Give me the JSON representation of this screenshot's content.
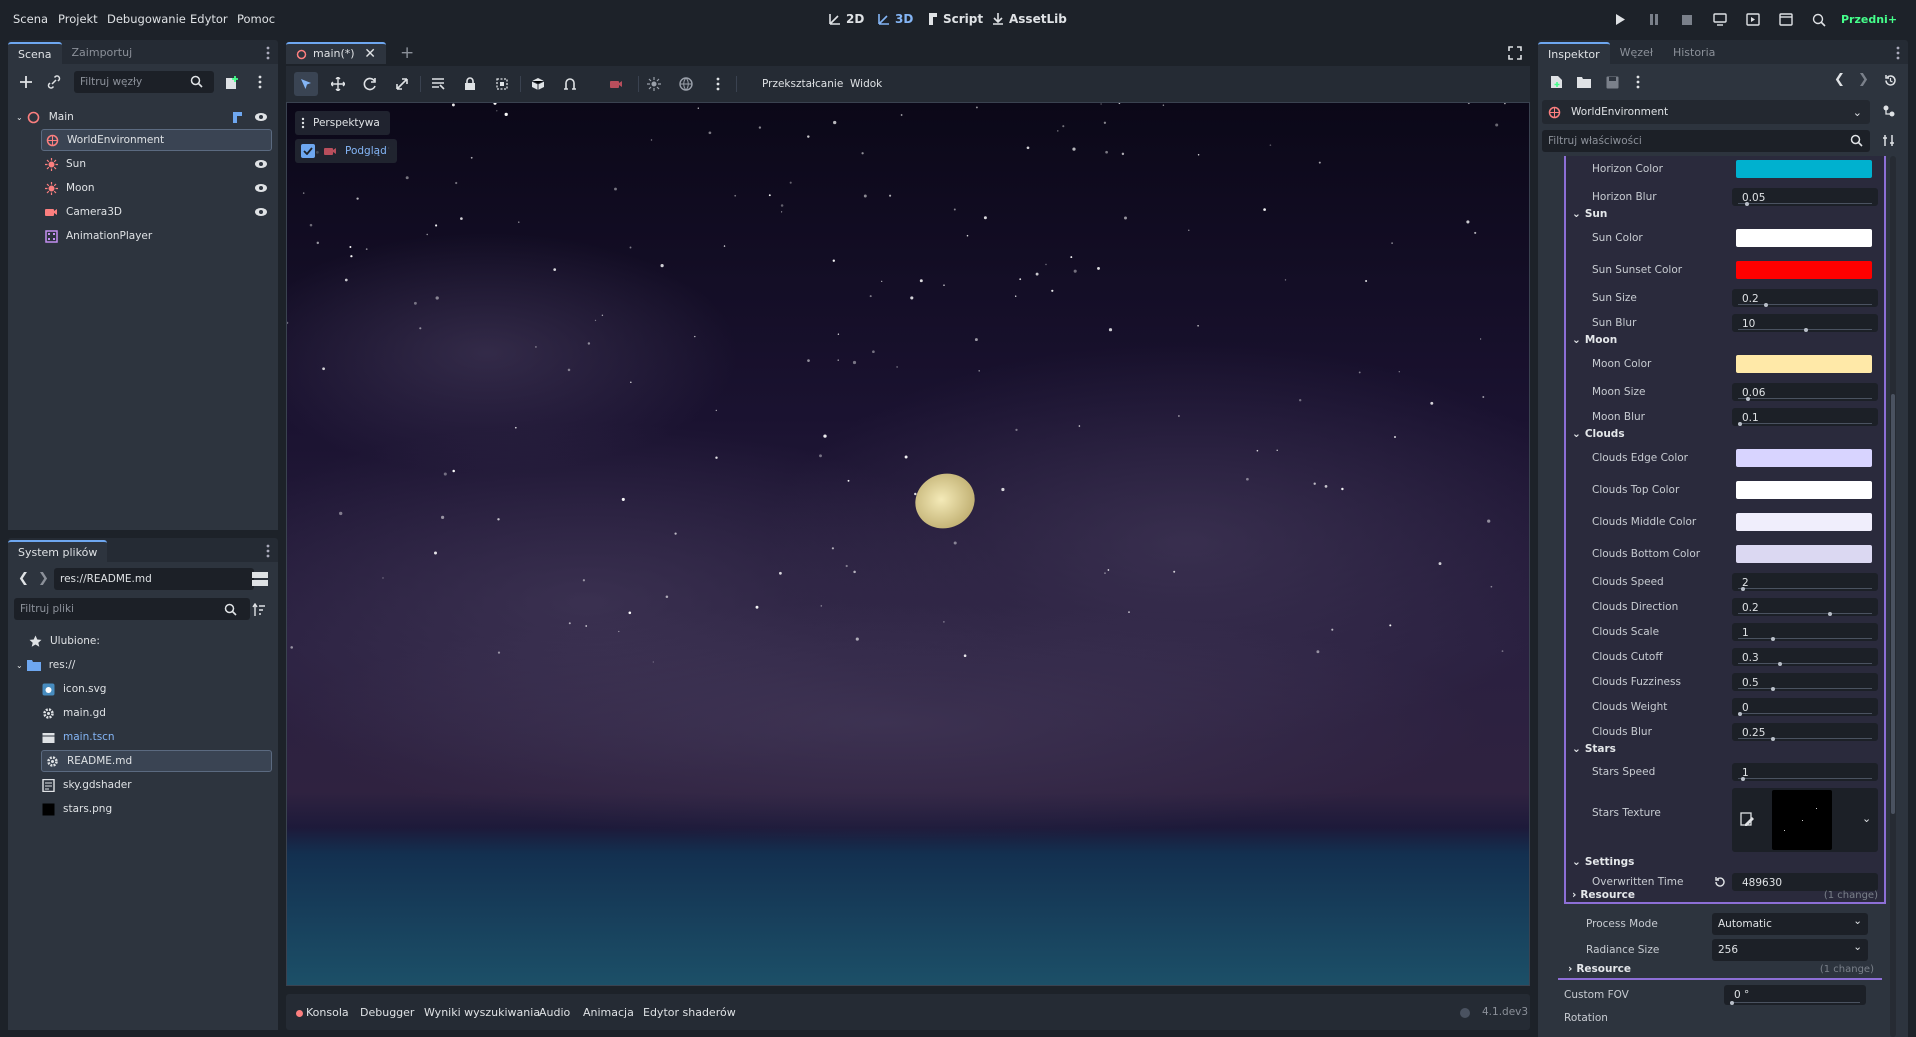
{
  "menu": [
    "Scena",
    "Projekt",
    "Debugowanie",
    "Edytor",
    "Pomoc"
  ],
  "workspaces": {
    "w2d": "2D",
    "w3d": "3D",
    "script": "Script",
    "assetlib": "AssetLib"
  },
  "renderer": "Przedni+",
  "scene_dock": {
    "tabs": [
      "Scena",
      "Zaimportuj"
    ],
    "filter_placeholder": "Filtruj węzły",
    "nodes": [
      {
        "name": "Main",
        "icon": "node3d-icon",
        "color": "#fc7f7f"
      },
      {
        "name": "WorldEnvironment",
        "icon": "world-environment-icon",
        "color": "#fc7f7f"
      },
      {
        "name": "Sun",
        "icon": "directional-light-icon",
        "color": "#fc7f7f"
      },
      {
        "name": "Moon",
        "icon": "directional-light-icon",
        "color": "#fc7f7f"
      },
      {
        "name": "Camera3D",
        "icon": "camera-icon",
        "color": "#fc7f7f"
      },
      {
        "name": "AnimationPlayer",
        "icon": "animation-player-icon",
        "color": "#c38ef1"
      }
    ]
  },
  "filesystem": {
    "tab": "System plików",
    "path": "res://README.md",
    "filter_placeholder": "Filtruj pliki",
    "favorites": "Ulubione:",
    "root": "res://",
    "files": [
      {
        "name": "icon.svg",
        "icon": "image-icon"
      },
      {
        "name": "main.gd",
        "icon": "gear-icon"
      },
      {
        "name": "main.tscn",
        "icon": "scene-icon"
      },
      {
        "name": "README.md",
        "icon": "gear-icon"
      },
      {
        "name": "sky.gdshader",
        "icon": "shader-icon"
      },
      {
        "name": "stars.png",
        "icon": "image-icon"
      }
    ]
  },
  "viewport": {
    "tab": "main(*)",
    "toolbar_transform": "Przekształcanie",
    "toolbar_view": "Widok",
    "perspective": "Perspektywa",
    "preview": "Podgląd"
  },
  "bottom_panel": {
    "tabs": [
      "Konsola",
      "Debugger",
      "Wyniki wyszukiwania",
      "Audio",
      "Animacja",
      "Edytor shaderów"
    ],
    "version": "4.1.dev3"
  },
  "inspector": {
    "tabs": [
      "Inspektor",
      "Węzeł",
      "Historia"
    ],
    "object": "WorldEnvironment",
    "filter_placeholder": "Filtruj właściwości",
    "props": {
      "horizon_color": {
        "label": "Horizon Color",
        "color": "#00b1cf"
      },
      "horizon_blur": {
        "label": "Horizon Blur",
        "value": "0.05",
        "level": 0.05
      },
      "sun_section": "Sun",
      "sun_color": {
        "label": "Sun Color",
        "color": "#ffffff"
      },
      "sun_sunset_color": {
        "label": "Sun Sunset Color",
        "color": "#ff0000"
      },
      "sun_size": {
        "label": "Sun Size",
        "value": "0.2",
        "level": 0.2
      },
      "sun_blur": {
        "label": "Sun Blur",
        "value": "10",
        "level": 0.5
      },
      "moon_section": "Moon",
      "moon_color": {
        "label": "Moon Color",
        "color": "#ffe9a8"
      },
      "moon_size": {
        "label": "Moon Size",
        "value": "0.06",
        "level": 0.06
      },
      "moon_blur": {
        "label": "Moon Blur",
        "value": "0.1",
        "level": 0.0
      },
      "clouds_section": "Clouds",
      "clouds_edge_color": {
        "label": "Clouds Edge Color",
        "color": "#d8d4ff"
      },
      "clouds_top_color": {
        "label": "Clouds Top Color",
        "color": "#ffffff"
      },
      "clouds_middle_color": {
        "label": "Clouds Middle Color",
        "color": "#f0eefc"
      },
      "clouds_bottom_color": {
        "label": "Clouds Bottom Color",
        "color": "#dbd8f2"
      },
      "clouds_speed": {
        "label": "Clouds Speed",
        "value": "2",
        "level": 0.02
      },
      "clouds_direction": {
        "label": "Clouds Direction",
        "value": "0.2",
        "level": 0.68
      },
      "clouds_scale": {
        "label": "Clouds Scale",
        "value": "1",
        "level": 0.25
      },
      "clouds_cutoff": {
        "label": "Clouds Cutoff",
        "value": "0.3",
        "level": 0.3
      },
      "clouds_fuzziness": {
        "label": "Clouds Fuzziness",
        "value": "0.5",
        "level": 0.25
      },
      "clouds_weight": {
        "label": "Clouds Weight",
        "value": "0",
        "level": 0.0
      },
      "clouds_blur": {
        "label": "Clouds Blur",
        "value": "0.25",
        "level": 0.25
      },
      "stars_section": "Stars",
      "stars_speed": {
        "label": "Stars Speed",
        "value": "1",
        "level": 0.02
      },
      "stars_texture": {
        "label": "Stars Texture"
      },
      "settings_section": "Settings",
      "overwritten_time": {
        "label": "Overwritten Time",
        "value": "489630"
      },
      "resource_inner": {
        "label": "Resource",
        "change": "(1 change)"
      },
      "process_mode": {
        "label": "Process Mode",
        "value": "Automatic"
      },
      "radiance_size": {
        "label": "Radiance Size",
        "value": "256"
      },
      "resource_outer": {
        "label": "Resource",
        "change": "(1 change)"
      },
      "custom_fov": {
        "label": "Custom FOV",
        "value": "0 °",
        "level": 0.0
      },
      "rotation": {
        "label": "Rotation"
      }
    }
  }
}
